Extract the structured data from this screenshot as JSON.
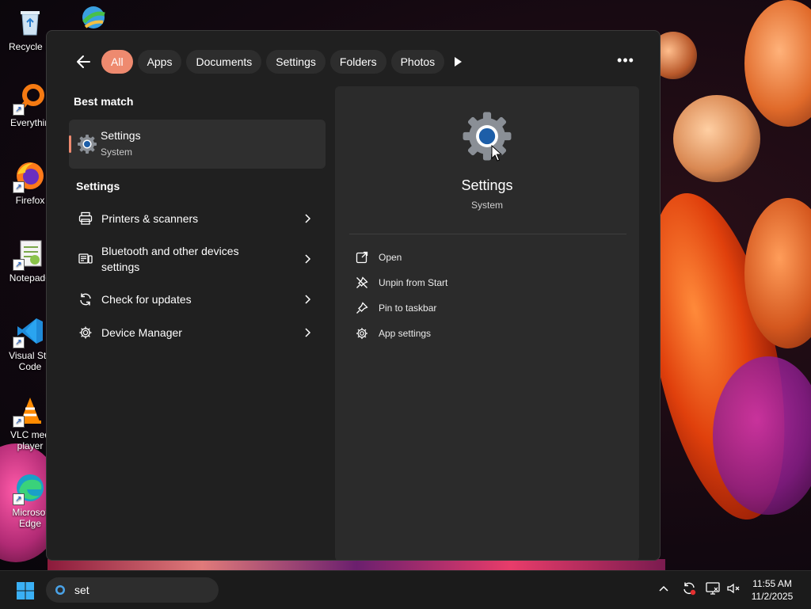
{
  "desktop": {
    "icons": [
      {
        "label": "Recycle B"
      },
      {
        "label": "Everythin"
      },
      {
        "label": "Firefox"
      },
      {
        "label": "Notepad+"
      },
      {
        "label": "Visual Stu Code"
      },
      {
        "label": "VLC med player"
      },
      {
        "label": "Microsof Edge"
      }
    ]
  },
  "search_panel": {
    "filters": [
      "All",
      "Apps",
      "Documents",
      "Settings",
      "Folders",
      "Photos"
    ],
    "active_filter": "All",
    "best_match_heading": "Best match",
    "best_match": {
      "title": "Settings",
      "subtitle": "System"
    },
    "settings_heading": "Settings",
    "settings_results": [
      {
        "label": "Printers & scanners",
        "icon": "printer-icon"
      },
      {
        "label": "Bluetooth and other devices settings",
        "icon": "devices-icon"
      },
      {
        "label": "Check for updates",
        "icon": "refresh-icon"
      },
      {
        "label": "Device Manager",
        "icon": "gear-small-icon"
      }
    ],
    "detail": {
      "title": "Settings",
      "subtitle": "System",
      "actions": [
        {
          "label": "Open",
          "icon": "open-external-icon"
        },
        {
          "label": "Unpin from Start",
          "icon": "unpin-icon"
        },
        {
          "label": "Pin to taskbar",
          "icon": "pin-icon"
        },
        {
          "label": "App settings",
          "icon": "gear-icon"
        }
      ]
    }
  },
  "taskbar": {
    "search_text": "set",
    "time": "11:55 AM",
    "date": "11/2/2025"
  },
  "colors": {
    "accent": "#ee8a6f",
    "panel_bg": "#202020",
    "detail_bg": "#2b2b2b"
  }
}
